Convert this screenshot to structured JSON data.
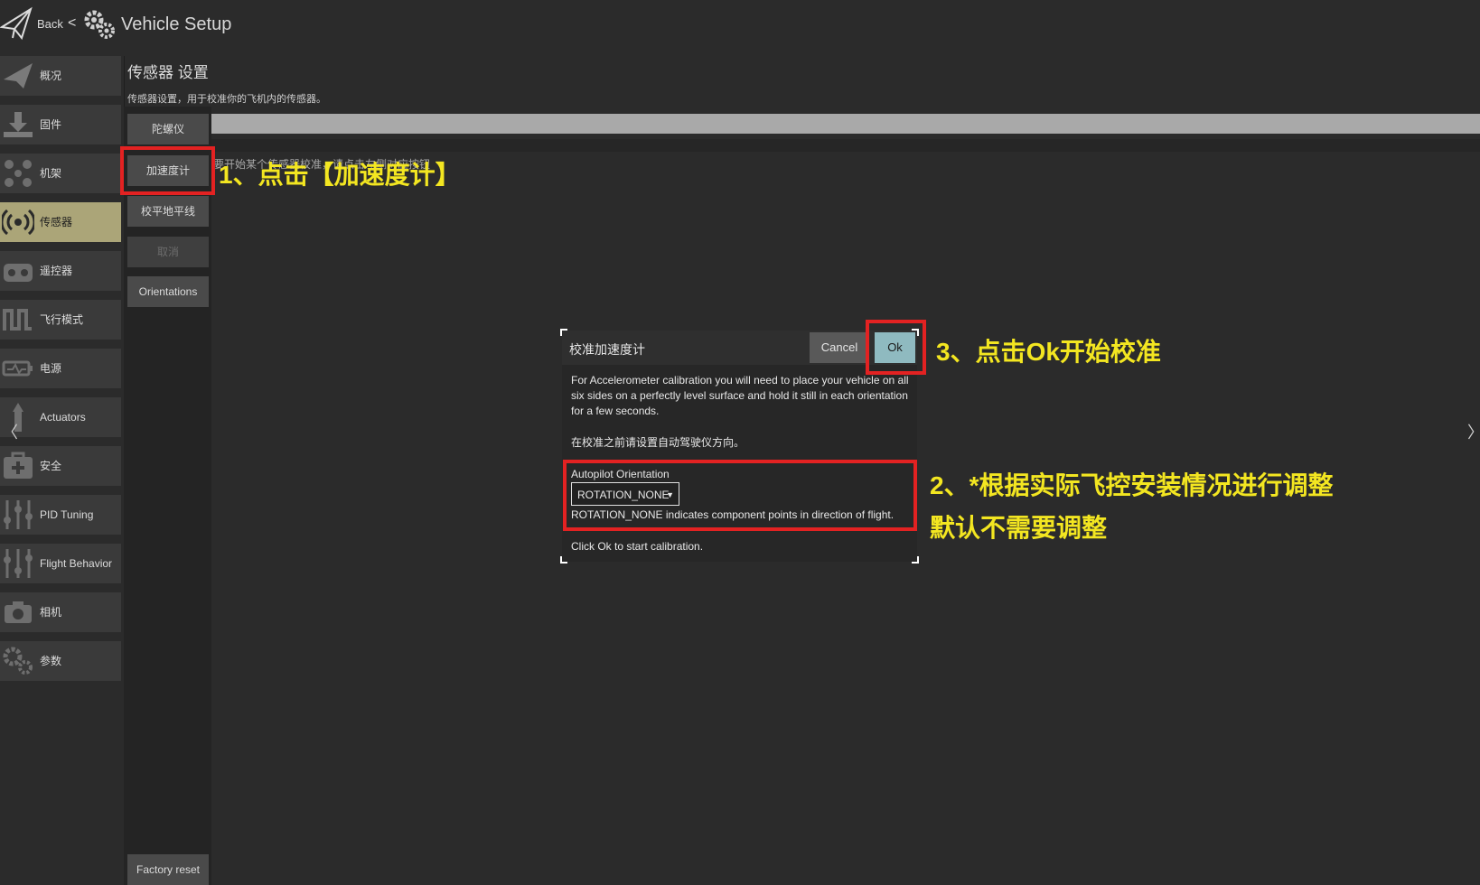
{
  "header": {
    "back_label": "Back",
    "separator": "<",
    "title": "Vehicle Setup"
  },
  "sidebar": {
    "items": [
      {
        "label": "概况",
        "icon": "paper-plane-icon"
      },
      {
        "label": "固件",
        "icon": "download-icon"
      },
      {
        "label": "机架",
        "icon": "airframe-icon"
      },
      {
        "label": "传感器",
        "icon": "sensor-icon",
        "active": true
      },
      {
        "label": "遥控器",
        "icon": "radio-icon"
      },
      {
        "label": "飞行模式",
        "icon": "flight-mode-icon"
      },
      {
        "label": "电源",
        "icon": "power-icon"
      },
      {
        "label": "Actuators",
        "icon": "actuators-icon"
      },
      {
        "label": "安全",
        "icon": "safety-icon"
      },
      {
        "label": "PID Tuning",
        "icon": "sliders-icon"
      },
      {
        "label": "Flight Behavior",
        "icon": "sliders-icon"
      },
      {
        "label": "相机",
        "icon": "camera-icon"
      },
      {
        "label": "参数",
        "icon": "gears-icon"
      }
    ]
  },
  "page": {
    "title": "传感器 设置",
    "description": "传感器设置，用于校准你的飞机内的传感器。",
    "hint": "要开始某个传感器校准，请点击左侧对应按钮"
  },
  "subnav": {
    "buttons": [
      "陀螺仪",
      "加速度计",
      "校平地平线",
      "取消",
      "Orientations"
    ],
    "factory_reset": "Factory reset"
  },
  "dialog": {
    "title": "校准加速度计",
    "cancel": "Cancel",
    "ok": "Ok",
    "body": "For Accelerometer calibration you will need to place your vehicle on all six sides on a perfectly level surface and hold it still in each orientation for a few seconds.",
    "body_cn": "在校准之前请设置自动驾驶仪方向。",
    "orientation_label": "Autopilot Orientation",
    "orientation_value": "ROTATION_NONE",
    "orientation_desc": "ROTATION_NONE indicates component points in direction of flight.",
    "footer": "Click Ok to start calibration."
  },
  "annotations": {
    "step1": "1、点击【加速度计】",
    "step2_line1": "2、*根据实际飞控安装情况进行调整",
    "step2_line2": "默认不需要调整",
    "step3": "3、点击Ok开始校准"
  },
  "nav_arrows": {
    "left": "〈",
    "right": "〉"
  },
  "colors": {
    "background": "#2b2b2b",
    "active_item": "#aba578",
    "ok_button": "#8fbac0",
    "annotation_red": "#e32222",
    "annotation_yellow": "#f3e621"
  }
}
